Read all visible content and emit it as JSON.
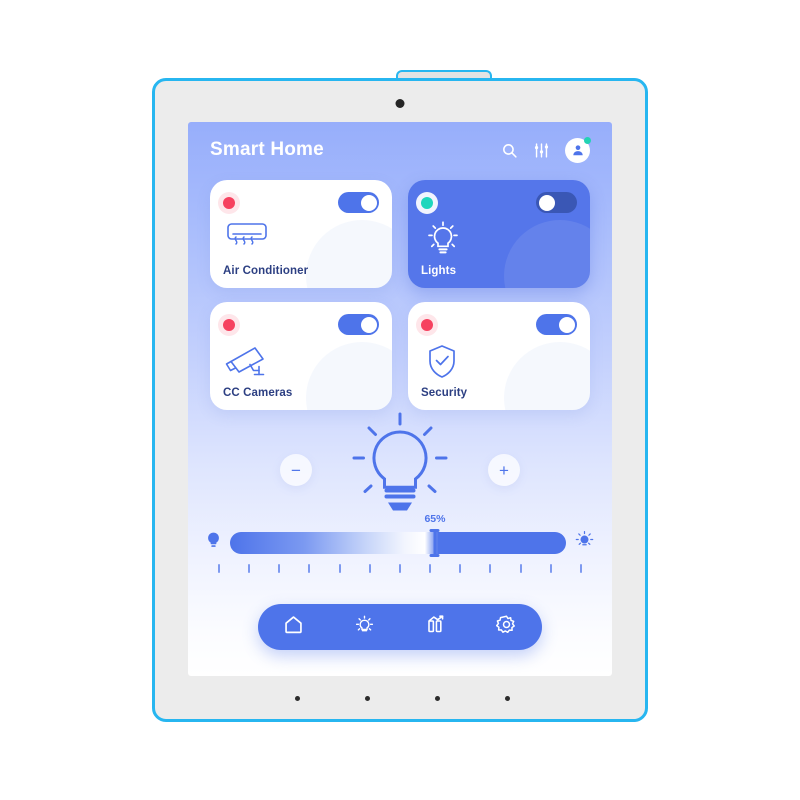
{
  "device": {
    "frame_name": "tablet",
    "accent_outline_color": "#27b6f0",
    "bezel_color": "#ececec",
    "front_camera": "front-camera",
    "speaker_dots": 4
  },
  "screen": {
    "background_gradient_from": "#97aefb",
    "background_gradient_to": "#ffffff"
  },
  "header": {
    "title": "Smart Home",
    "actions": [
      {
        "name": "search-icon",
        "label": "Search"
      },
      {
        "name": "filter-sliders-icon",
        "label": "Filters"
      },
      {
        "name": "avatar",
        "label": "Profile",
        "badge_color": "#22d3b4"
      }
    ]
  },
  "devices": [
    {
      "label": "Air Conditioner",
      "icon": "air-conditioner-icon",
      "status_color": "#f6415f",
      "toggle_on": true,
      "active": false
    },
    {
      "label": "Lights",
      "icon": "light-bulb-icon",
      "status_color": "#1fd6bd",
      "toggle_on": false,
      "active": true
    },
    {
      "label": "CC Cameras",
      "icon": "cctv-camera-icon",
      "status_color": "#f6415f",
      "toggle_on": true,
      "active": false
    },
    {
      "label": "Security",
      "icon": "shield-check-icon",
      "status_color": "#f6415f",
      "toggle_on": true,
      "active": false
    }
  ],
  "bulb_control": {
    "decrease_label": "−",
    "increase_label": "+",
    "icon": "glowing-bulb-icon"
  },
  "brightness": {
    "value_label": "65%",
    "value_percent": 65,
    "min_icon": "dim-bulb-icon",
    "max_icon": "bright-bulb-icon",
    "tick_count": 13
  },
  "bottom_nav": [
    {
      "name": "nav-home",
      "icon": "home-icon",
      "label": "Home"
    },
    {
      "name": "nav-lights",
      "icon": "bulb-icon",
      "label": "Lights"
    },
    {
      "name": "nav-stats",
      "icon": "bar-chart-icon",
      "label": "Stats"
    },
    {
      "name": "nav-settings",
      "icon": "gear-icon",
      "label": "Settings"
    }
  ],
  "theme": {
    "primary": "#4e74ea",
    "card_active": "#5576ea",
    "text_dark": "#2c3f82",
    "danger": "#f6415f",
    "success": "#1fd6bd"
  }
}
